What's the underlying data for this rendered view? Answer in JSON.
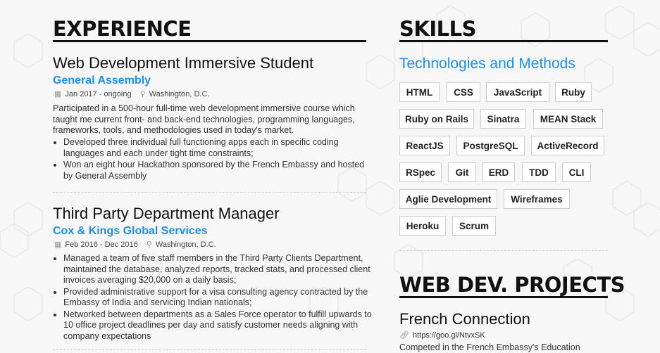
{
  "experience": {
    "heading": "EXPERIENCE",
    "jobs": [
      {
        "title": "Web Development Immersive Student",
        "company": "General Assembly",
        "dates": "Jan 2017 - ongoing",
        "location": "Washington, D.C.",
        "description": "Participated in a 500-hour full-time web development immersive course which taught me current front- and back-end technologies, programming languages, frameworks, tools, and methodologies used in today's market.",
        "bullets": [
          "Developed three individual full functioning apps each in specific coding languages and each under tight time constraints;",
          "Won an eight hour Hackathon sponsored by the French Embassy and hosted by General Assembly"
        ]
      },
      {
        "title": "Third Party Department Manager",
        "company": "Cox & Kings Global Services",
        "dates": "Feb 2016 - Dec 2016",
        "location": "Washington, D.C.",
        "bullets": [
          "Managed a team of five staff members in the Third Party Clients Department, maintained the database, analyzed reports, tracked stats, and processed client invoices averaging $20,000 on a daily basis;",
          "Provided administrative support for a visa consulting agency contracted by the Embassy of India and servicing Indian nationals;",
          "Networked between departments as a Sales Force operator to fulfill upwards to 10 office project deadlines per day and satisfy customer needs aligning with company expectations"
        ]
      }
    ]
  },
  "skills": {
    "heading": "SKILLS",
    "subheading": "Technologies and Methods",
    "tags": [
      "HTML",
      "CSS",
      "JavaScript",
      "Ruby",
      "Ruby on Rails",
      "Sinatra",
      "MEAN Stack",
      "ReactJS",
      "PostgreSQL",
      "ActiveRecord",
      "RSpec",
      "Git",
      "ERD",
      "TDD",
      "CLI",
      "Aglie Development",
      "Wireframes",
      "Heroku",
      "Scrum"
    ]
  },
  "projects": {
    "heading": "WEB DEV.  PROJECTS",
    "items": [
      {
        "title": "French Connection",
        "link": "https://goo.gl/NtvxSK",
        "description": "Competed in the French Embassy's Education"
      }
    ]
  },
  "icons": {
    "calendar": "calendar-icon",
    "location": "map-marker-icon",
    "link": "link-icon"
  },
  "colors": {
    "accent": "#1e8fe6",
    "heading": "#111111",
    "background": "#f7f7f7"
  }
}
